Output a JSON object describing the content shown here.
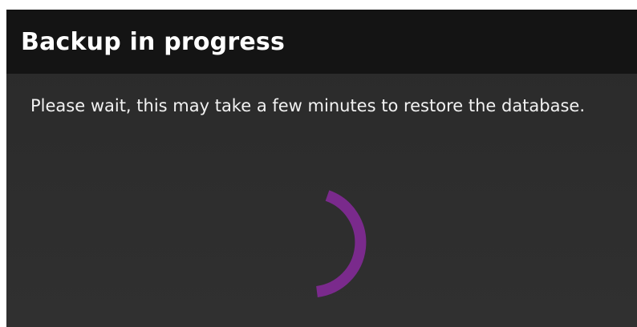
{
  "dialog": {
    "title": "Backup in progress",
    "message": "Please wait, this may take a few minutes to restore the database.",
    "spinner_color": "#7a2a8c",
    "header_color": "#141414",
    "background_color": "#2d2d2d"
  }
}
